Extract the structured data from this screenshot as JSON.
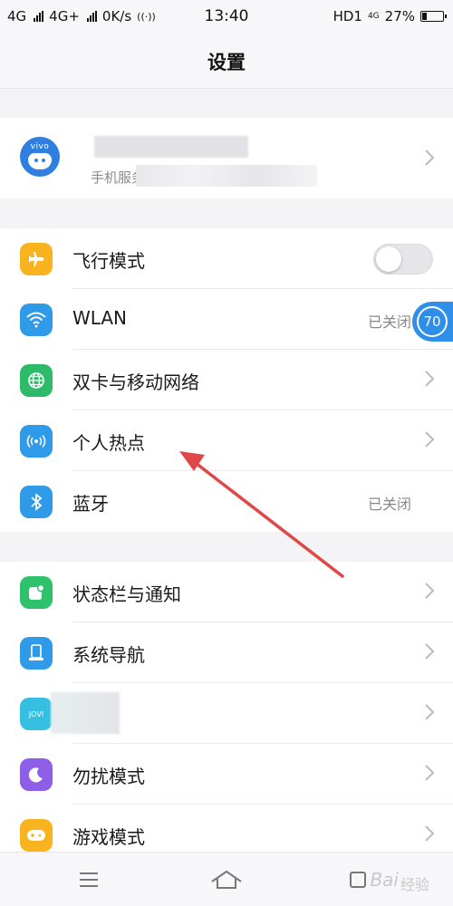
{
  "status_bar": {
    "net1": "4G",
    "net2": "4G+",
    "speed": "0K/s",
    "time": "13:40",
    "hd": "HD1",
    "net3": "4G",
    "battery_text": "27%",
    "battery_level": 0.27
  },
  "header": {
    "title": "设置"
  },
  "account": {
    "avatar_brand": "vivo",
    "subtitle": "手机服务、云"
  },
  "floating_badge": {
    "value": "70"
  },
  "section1": [
    {
      "label": "飞行模式",
      "icon": "airplane-icon",
      "color": "#f8b31f",
      "toggle_on": false
    },
    {
      "label": "WLAN",
      "icon": "wifi-icon",
      "color": "#2e9ae8",
      "value": "已关闭"
    },
    {
      "label": "双卡与移动网络",
      "icon": "globe-icon",
      "color": "#2dbb6a"
    },
    {
      "label": "个人热点",
      "icon": "hotspot-icon",
      "color": "#2e9ae8"
    },
    {
      "label": "蓝牙",
      "icon": "bluetooth-icon",
      "color": "#2e9ae8",
      "value": "已关闭"
    }
  ],
  "section2": [
    {
      "label": "状态栏与通知",
      "icon": "notification-icon",
      "color": "#2dc26b"
    },
    {
      "label": "系统导航",
      "icon": "navigation-icon",
      "color": "#2e9ae8"
    },
    {
      "label": "",
      "icon": "jovi-icon",
      "color": "#35bfe0"
    },
    {
      "label": "勿扰模式",
      "icon": "moon-icon",
      "color": "#8e5ee6"
    },
    {
      "label": "游戏模式",
      "icon": "gamepad-icon",
      "color": "#f8b31f"
    }
  ],
  "nav": {
    "watermark_logo": "Bai",
    "watermark_text": "经验"
  },
  "colors": {
    "annotation_arrow": "#e04848"
  }
}
